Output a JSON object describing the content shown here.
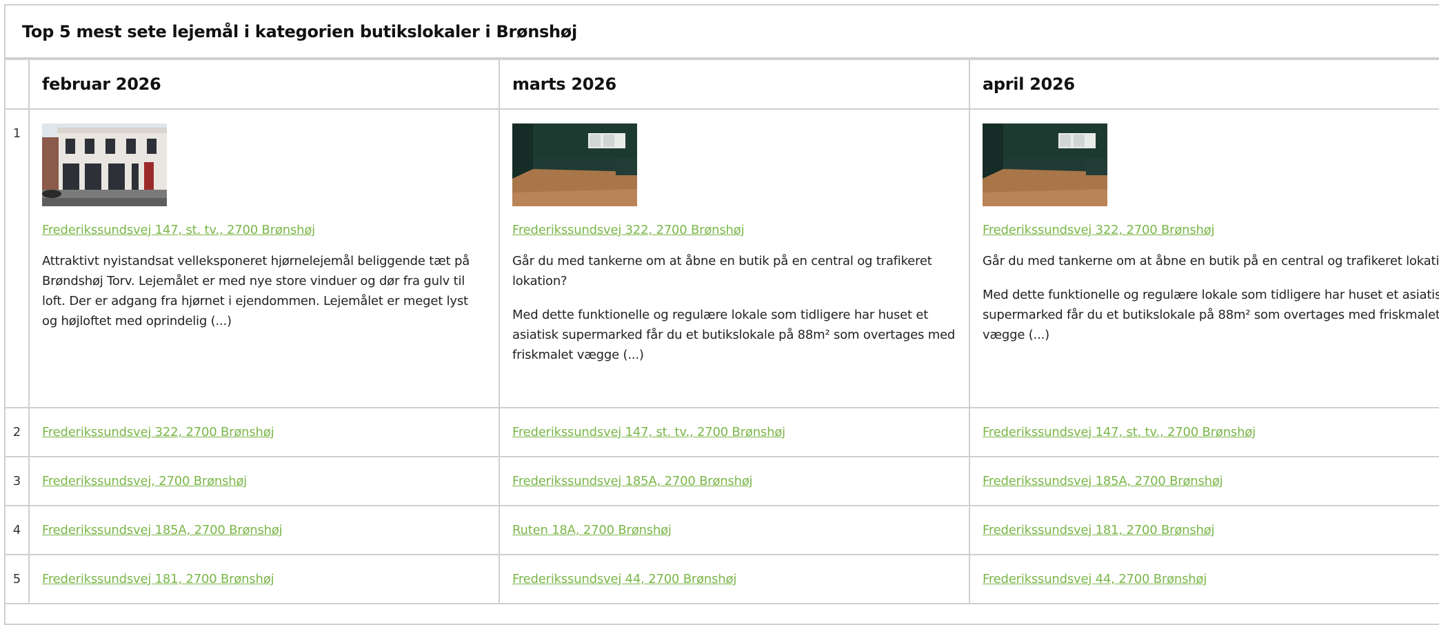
{
  "caption": "Top 5 mest sete lejemål i kategorien butikslokaler i Brønshøj",
  "columns": [
    "februar 2026",
    "marts 2026",
    "april 2026"
  ],
  "rows": [
    {
      "rank": "1",
      "cells": [
        {
          "image": "photo-storefront-corner",
          "address": "Frederikssundsvej 147, st. tv., 2700 Brønshøj",
          "paragraphs": [
            "Attraktivt nyistandsat velleksponeret hjørnelejemål beliggende tæt på Brøndshøj Torv. Lejemålet er med nye store vinduer og dør fra gulv til loft. Der er adgang fra hjørnet i ejendommen. Lejemålet er meget lyst og højloftet med oprindelig (...)"
          ]
        },
        {
          "image": "photo-empty-shop-interior",
          "address": "Frederikssundsvej 322, 2700 Brønshøj",
          "paragraphs": [
            "Går du med tankerne om at åbne en butik på en central og trafikeret lokation?",
            "Med dette funktionelle og regulære lokale som tidligere har huset et asiatisk supermarked får du et butikslokale på 88m² som overtages med friskmalet vægge (...)"
          ]
        },
        {
          "image": "photo-empty-shop-interior",
          "address": "Frederikssundsvej 322, 2700 Brønshøj",
          "paragraphs": [
            "Går du med tankerne om at åbne en butik på en central og trafikeret lokation?",
            "Med dette funktionelle og regulære lokale som tidligere har huset et asiatisk supermarked får du et butikslokale på 88m² som overtages med friskmalet vægge (...)"
          ]
        }
      ]
    },
    {
      "rank": "2",
      "cells": [
        {
          "address": "Frederikssundsvej 322, 2700 Brønshøj"
        },
        {
          "address": "Frederikssundsvej 147, st. tv., 2700 Brønshøj"
        },
        {
          "address": "Frederikssundsvej 147, st. tv., 2700 Brønshøj"
        }
      ]
    },
    {
      "rank": "3",
      "cells": [
        {
          "address": "Frederikssundsvej, 2700 Brønshøj"
        },
        {
          "address": "Frederikssundsvej 185A, 2700 Brønshøj"
        },
        {
          "address": "Frederikssundsvej 185A, 2700 Brønshøj"
        }
      ]
    },
    {
      "rank": "4",
      "cells": [
        {
          "address": "Frederikssundsvej 185A, 2700 Brønshøj"
        },
        {
          "address": "Ruten 18A, 2700 Brønshøj"
        },
        {
          "address": "Frederikssundsvej 181, 2700 Brønshøj"
        }
      ]
    },
    {
      "rank": "5",
      "cells": [
        {
          "address": "Frederikssundsvej 181, 2700 Brønshøj"
        },
        {
          "address": "Frederikssundsvej 44, 2700 Brønshøj"
        },
        {
          "address": "Frederikssundsvej 44, 2700 Brønshøj"
        }
      ]
    }
  ],
  "colors": {
    "link": "#7ab648",
    "border": "#cfcfcf"
  }
}
